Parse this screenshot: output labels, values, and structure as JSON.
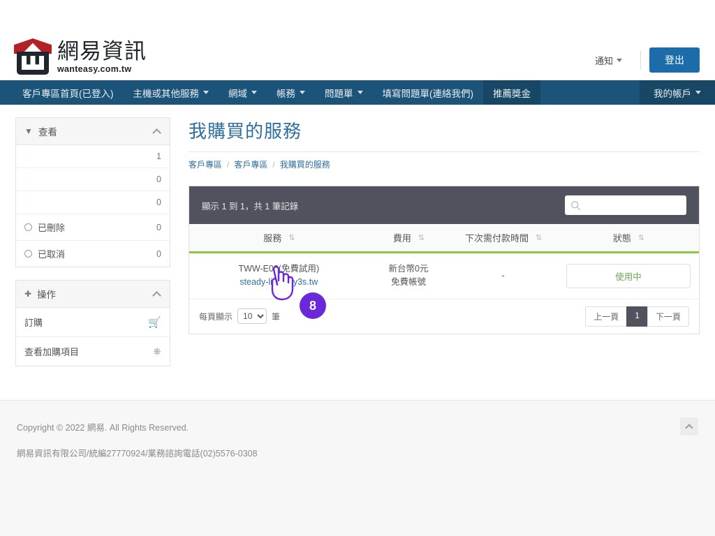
{
  "header": {
    "brand_cn": "網易資訊",
    "brand_en": "wanteasy.com.tw",
    "notify_label": "通知",
    "logout_label": "登出"
  },
  "nav": {
    "items": [
      {
        "label": "客戶專區首頁(已登入)",
        "has_caret": false,
        "active": false
      },
      {
        "label": "主機或其他服務",
        "has_caret": true,
        "active": false
      },
      {
        "label": "網域",
        "has_caret": true,
        "active": false
      },
      {
        "label": "帳務",
        "has_caret": true,
        "active": false
      },
      {
        "label": "問題單",
        "has_caret": true,
        "active": false
      },
      {
        "label": "填寫問題單(連絡我們)",
        "has_caret": false,
        "active": false
      },
      {
        "label": "推薦獎金",
        "has_caret": false,
        "active": true
      }
    ],
    "account_label": "我的帳戶"
  },
  "sidebar": {
    "view_panel": {
      "title": "查看",
      "icon": "filter-icon",
      "rows": [
        {
          "label": "",
          "count": "1",
          "obscured": true
        },
        {
          "label": "",
          "count": "0",
          "obscured": true
        },
        {
          "label": "",
          "count": "0",
          "obscured": true
        },
        {
          "label": "已刪除",
          "count": "0",
          "obscured": false
        },
        {
          "label": "已取消",
          "count": "0",
          "obscured": false
        }
      ]
    },
    "action_panel": {
      "title": "操作",
      "icon": "plus-icon",
      "rows": [
        {
          "label": "訂購",
          "icon": "cart-icon"
        },
        {
          "label": "查看加購項目",
          "icon": "addons-icon"
        }
      ]
    }
  },
  "main": {
    "title": "我購買的服務",
    "breadcrumb": [
      {
        "label": "客戶專區"
      },
      {
        "label": "客戶專區"
      },
      {
        "label": "我購買的服務"
      }
    ],
    "toolbar": {
      "info": "顯示 1 到 1，共 1 筆記錄",
      "search_value": "",
      "search_placeholder": ""
    },
    "table": {
      "columns": [
        {
          "label": "服務",
          "sort": "sort-desc-icon"
        },
        {
          "label": "費用",
          "sort": "sort-both-icon"
        },
        {
          "label": "下次需付款時間",
          "sort": "sort-both-icon"
        },
        {
          "label": "狀態",
          "sort": "sort-desc-icon"
        }
      ],
      "rows": [
        {
          "service_name": "TWW-E02(免費試用)",
          "service_domain": "steady-life.why3s.tw",
          "fee_amount": "新台幣0元",
          "fee_note": "免費帳號",
          "next_payment": "-",
          "status": "使用中"
        }
      ]
    },
    "footer_bar": {
      "perpage_label": "每頁顯示",
      "perpage_value": "10",
      "perpage_suffix": "筆",
      "prev_label": "上一頁",
      "current_page": "1",
      "next_label": "下一頁"
    }
  },
  "footer": {
    "copyright": "Copyright © 2022 網易. All Rights Reserved.",
    "company": "網易資訊有限公司/統編27770924/業務諮詢電話(02)5576-0308",
    "to_top_icon": "chevron-up-icon"
  },
  "overlay": {
    "step_number": "8",
    "cursor_icon": "pointing-hand-cursor",
    "accent_color": "#6a28d9"
  }
}
